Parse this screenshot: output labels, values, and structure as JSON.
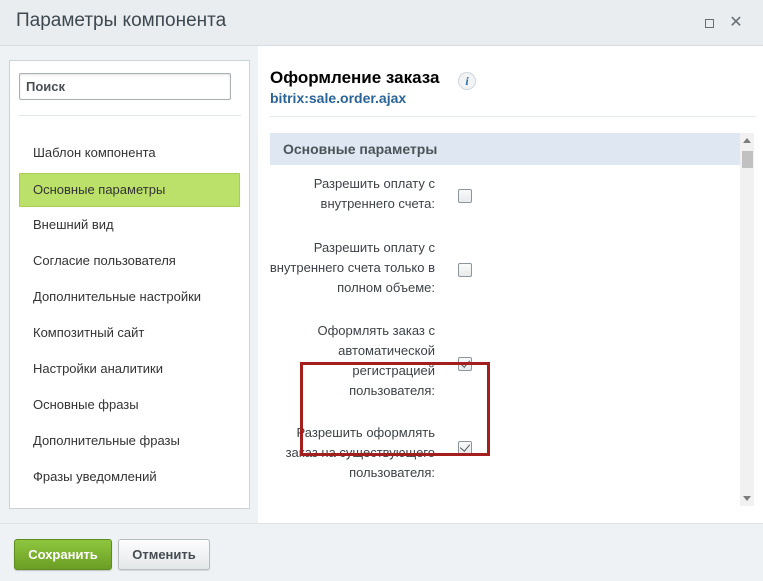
{
  "window": {
    "title": "Параметры компонента",
    "maximize_icon": "maximize-icon",
    "close_icon": "close-icon"
  },
  "sidebar": {
    "search_placeholder": "Поиск",
    "items": [
      {
        "label": "Шаблон компонента",
        "active": false
      },
      {
        "label": "Основные параметры",
        "active": true
      },
      {
        "label": "Внешний вид",
        "active": false
      },
      {
        "label": "Согласие пользователя",
        "active": false
      },
      {
        "label": "Дополнительные настройки",
        "active": false
      },
      {
        "label": "Композитный сайт",
        "active": false
      },
      {
        "label": "Настройки аналитики",
        "active": false
      },
      {
        "label": "Основные фразы",
        "active": false
      },
      {
        "label": "Дополнительные фразы",
        "active": false
      },
      {
        "label": "Фразы уведомлений",
        "active": false
      }
    ],
    "active_color": "#bbe16a"
  },
  "component": {
    "title": "Оформление заказа",
    "code": "bitrix:sale.order.ajax",
    "info_icon": "i"
  },
  "section": {
    "title": "Основные параметры",
    "params": [
      {
        "label": "Разрешить оплату с внутреннего счета:",
        "checked": false
      },
      {
        "label": "Разрешить оплату с внутреннего счета только в полном объеме:",
        "checked": false
      },
      {
        "label": "Оформлять заказ с автоматической регистрацией пользователя:",
        "checked": true,
        "highlighted": true
      },
      {
        "label": "Разрешить оформлять заказ на существующего пользователя:",
        "checked": true
      }
    ]
  },
  "footer": {
    "save_label": "Сохранить",
    "cancel_label": "Отменить"
  },
  "colors": {
    "save_button": "#7ab231",
    "highlight_border": "#a51e1e",
    "section_header_bg": "#dfe8f2",
    "component_code": "#2a6496"
  }
}
